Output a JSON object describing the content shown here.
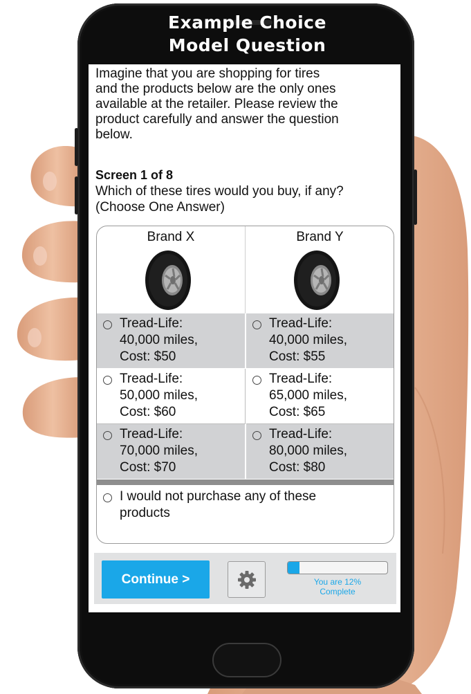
{
  "title": {
    "line1": "Example Choice",
    "line2": "Model Question"
  },
  "intro": [
    "Imagine that you are shopping for tires",
    "and the products below are the only ones",
    "available at the retailer.  Please review the",
    "product carefully and answer the question",
    "below."
  ],
  "screen_count": "Screen 1 of 8",
  "question": [
    "Which of these tires would you buy, if any?",
    "(Choose One Answer)"
  ],
  "brands": [
    {
      "name": "Brand X"
    },
    {
      "name": "Brand Y"
    }
  ],
  "options": [
    {
      "left": {
        "line1": "Tread-Life:",
        "line2": "40,000 miles,",
        "line3": "Cost: $50"
      },
      "right": {
        "line1": "Tread-Life:",
        "line2": "40,000 miles,",
        "line3": "Cost: $55"
      }
    },
    {
      "left": {
        "line1": "Tread-Life:",
        "line2": "50,000 miles,",
        "line3": "Cost: $60"
      },
      "right": {
        "line1": "Tread-Life:",
        "line2": "65,000 miles,",
        "line3": "Cost: $65"
      }
    },
    {
      "left": {
        "line1": "Tread-Life:",
        "line2": "70,000 miles,",
        "line3": "Cost: $70"
      },
      "right": {
        "line1": "Tread-Life:",
        "line2": "80,000 miles,",
        "line3": "Cost: $80"
      }
    }
  ],
  "none_option": {
    "line1": "I would not purchase any of these",
    "line2": "products"
  },
  "bottom_bar": {
    "continue_label": "Continue >",
    "gear_icon": "gear-icon",
    "progress_fraction": 0.12,
    "progress_line1": "You are 12%",
    "progress_line2": "Complete"
  },
  "colors": {
    "accent": "#1aa7e8",
    "option_shade": "#d1d2d4",
    "phone_body": "#0d0d0d",
    "skin": "#e9b595"
  }
}
